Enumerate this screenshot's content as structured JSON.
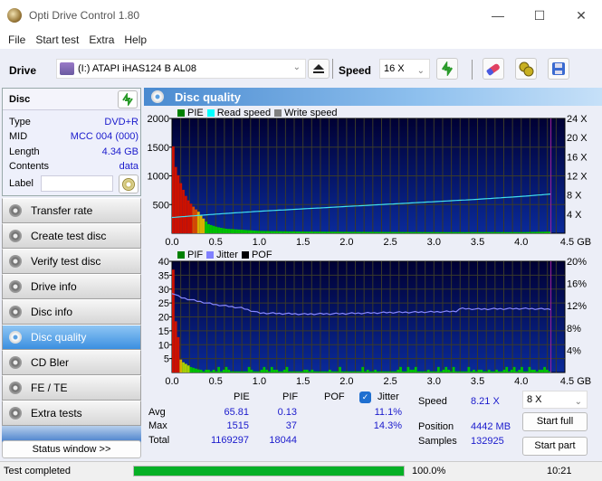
{
  "window": {
    "title": "Opti Drive Control 1.80",
    "minimize": "—",
    "maximize": "☐",
    "close": "✕"
  },
  "menu": [
    "File",
    "Start test",
    "Extra",
    "Help"
  ],
  "toolbar": {
    "drive_label": "Drive",
    "drive_value": "(I:)   ATAPI iHAS124   B AL08",
    "speed_label": "Speed",
    "speed_value": "16 X",
    "icons": [
      "eject-icon",
      "refresh-icon",
      "erase-icon",
      "settings-icon",
      "save-icon"
    ]
  },
  "disc": {
    "title": "Disc",
    "rows": [
      {
        "key": "Type",
        "value": "DVD+R"
      },
      {
        "key": "MID",
        "value": "MCC 004 (000)"
      },
      {
        "key": "Length",
        "value": "4.34 GB"
      },
      {
        "key": "Contents",
        "value": "data"
      }
    ],
    "label_key": "Label",
    "label_value": ""
  },
  "nav": [
    {
      "label": "Transfer rate",
      "active": false
    },
    {
      "label": "Create test disc",
      "active": false
    },
    {
      "label": "Verify test disc",
      "active": false
    },
    {
      "label": "Drive info",
      "active": false
    },
    {
      "label": "Disc info",
      "active": false
    },
    {
      "label": "Disc quality",
      "active": true
    },
    {
      "label": "CD Bler",
      "active": false
    },
    {
      "label": "FE / TE",
      "active": false
    },
    {
      "label": "Extra tests",
      "active": false
    }
  ],
  "status_window_label": "Status window >>",
  "panel": {
    "title": "Disc quality"
  },
  "colors": {
    "plot_bg_top": "#000033",
    "plot_bg_bottom": "#0a2a9a",
    "grid": "#3a3a2a",
    "pie": "#00c000",
    "read": "#40e0f0",
    "jitter": "#8888ff",
    "marker": "#a020a0"
  },
  "chart_data": [
    {
      "type": "area",
      "title": "",
      "legend": [
        {
          "name": "PIE",
          "color": "#008000"
        },
        {
          "name": "Read speed",
          "color": "#00ffff"
        },
        {
          "name": "Write speed",
          "color": "#808080"
        }
      ],
      "legend_position": "top-left",
      "xlabel": "GB",
      "x_ticks": [
        "0.0",
        "0.5",
        "1.0",
        "1.5",
        "2.0",
        "2.5",
        "3.0",
        "3.5",
        "4.0",
        "4.5 GB"
      ],
      "xlim": [
        0,
        4.5
      ],
      "y_left_ticks": [
        "2000",
        "1500",
        "1000",
        "500"
      ],
      "ylim_left": [
        0,
        2000
      ],
      "y_right_ticks": [
        "24 X",
        "20 X",
        "16 X",
        "12 X",
        "8 X",
        "4 X"
      ],
      "ylim_right": [
        0,
        24
      ],
      "grid": true,
      "series": [
        {
          "name": "PIE",
          "x": [
            0.0,
            0.02,
            0.05,
            0.08,
            0.1,
            0.13,
            0.16,
            0.2,
            0.25,
            0.3,
            0.35,
            0.4,
            0.5,
            0.6,
            0.8,
            1.0,
            1.5,
            2.0,
            3.0,
            4.0,
            4.34
          ],
          "y": [
            1515,
            1200,
            1050,
            900,
            820,
            700,
            600,
            520,
            430,
            360,
            250,
            160,
            110,
            80,
            60,
            40,
            30,
            25,
            20,
            20,
            30
          ]
        },
        {
          "name": "Read speed",
          "x": [
            0.0,
            0.5,
            1.0,
            1.5,
            2.0,
            2.5,
            3.0,
            3.5,
            4.0,
            4.34
          ],
          "y": [
            3.3,
            4.0,
            4.6,
            5.1,
            5.6,
            6.1,
            6.6,
            7.1,
            7.7,
            8.2
          ]
        }
      ],
      "end_marker_x": 4.34
    },
    {
      "type": "bar",
      "legend": [
        {
          "name": "PIF",
          "color": "#008000"
        },
        {
          "name": "Jitter",
          "color": "#8080ff"
        },
        {
          "name": "POF",
          "color": "#000000"
        }
      ],
      "legend_position": "top-left",
      "x_ticks": [
        "0.0",
        "0.5",
        "1.0",
        "1.5",
        "2.0",
        "2.5",
        "3.0",
        "3.5",
        "4.0",
        "4.5 GB"
      ],
      "xlim": [
        0,
        4.5
      ],
      "y_left_ticks": [
        "40",
        "35",
        "30",
        "25",
        "20",
        "15",
        "10",
        "5"
      ],
      "ylim_left": [
        0,
        40
      ],
      "y_right_ticks": [
        "20%",
        "16%",
        "12%",
        "8%",
        "4%"
      ],
      "ylim_right": [
        0,
        20
      ],
      "grid": true,
      "series": [
        {
          "name": "PIF",
          "x": [
            0.0,
            0.01,
            0.02,
            0.03,
            0.04,
            0.05,
            0.06,
            0.08,
            0.1,
            0.15,
            0.2,
            0.3
          ],
          "y": [
            37,
            30,
            22,
            18,
            13,
            8,
            14,
            5,
            4,
            3,
            2,
            1
          ]
        },
        {
          "name": "Jitter",
          "x": [
            0.0,
            0.1,
            0.3,
            0.5,
            0.8,
            1.0,
            1.5,
            2.0,
            2.5,
            3.0,
            3.25,
            3.3,
            3.5,
            4.0,
            4.34
          ],
          "y": [
            14.3,
            13.5,
            12.8,
            12.2,
            11.6,
            10.7,
            10.5,
            10.6,
            10.8,
            10.9,
            11.0,
            11.5,
            11.4,
            11.5,
            11.4
          ]
        }
      ],
      "end_marker_x": 4.34
    }
  ],
  "stats": {
    "headers": [
      "PIE",
      "PIF",
      "POF",
      "Jitter"
    ],
    "jitter_checked": true,
    "rows": [
      {
        "label": "Avg",
        "pie": "65.81",
        "pif": "0.13",
        "pof": "",
        "jitter": "11.1%"
      },
      {
        "label": "Max",
        "pie": "1515",
        "pif": "37",
        "pof": "",
        "jitter": "14.3%"
      },
      {
        "label": "Total",
        "pie": "1169297",
        "pif": "18044",
        "pof": "",
        "jitter": ""
      }
    ],
    "speed_label": "Speed",
    "speed_value": "8.21 X",
    "position_label": "Position",
    "position_value": "4442 MB",
    "samples_label": "Samples",
    "samples_value": "132925",
    "speed_select": "8 X",
    "start_full": "Start full",
    "start_part": "Start part"
  },
  "statusbar": {
    "text": "Test completed",
    "progress": 100.0,
    "progress_text": "100.0%",
    "time": "10:21"
  }
}
